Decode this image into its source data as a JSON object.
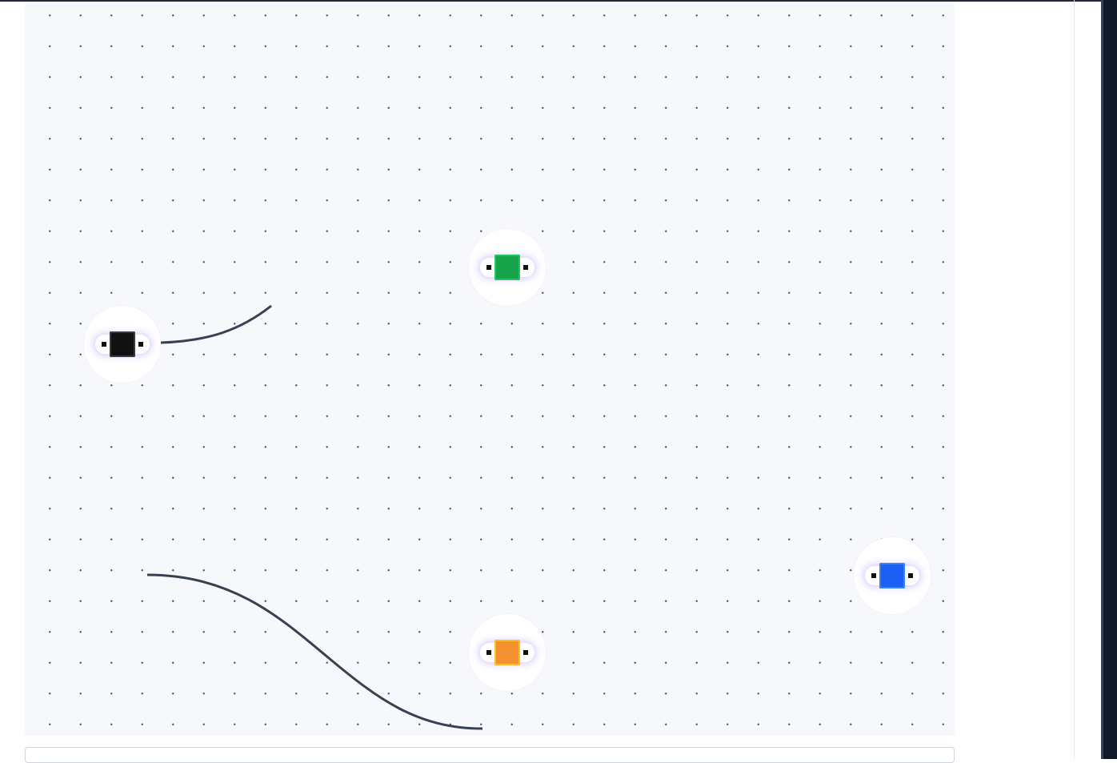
{
  "canvas": {
    "nodes": [
      {
        "name": "black-node",
        "color": "#111111"
      },
      {
        "name": "green-node",
        "color": "#16a34a"
      },
      {
        "name": "blue-node",
        "color": "#1d5ff5"
      },
      {
        "name": "orange-node",
        "color": "#f59032"
      }
    ],
    "wire_color": "#374151"
  }
}
